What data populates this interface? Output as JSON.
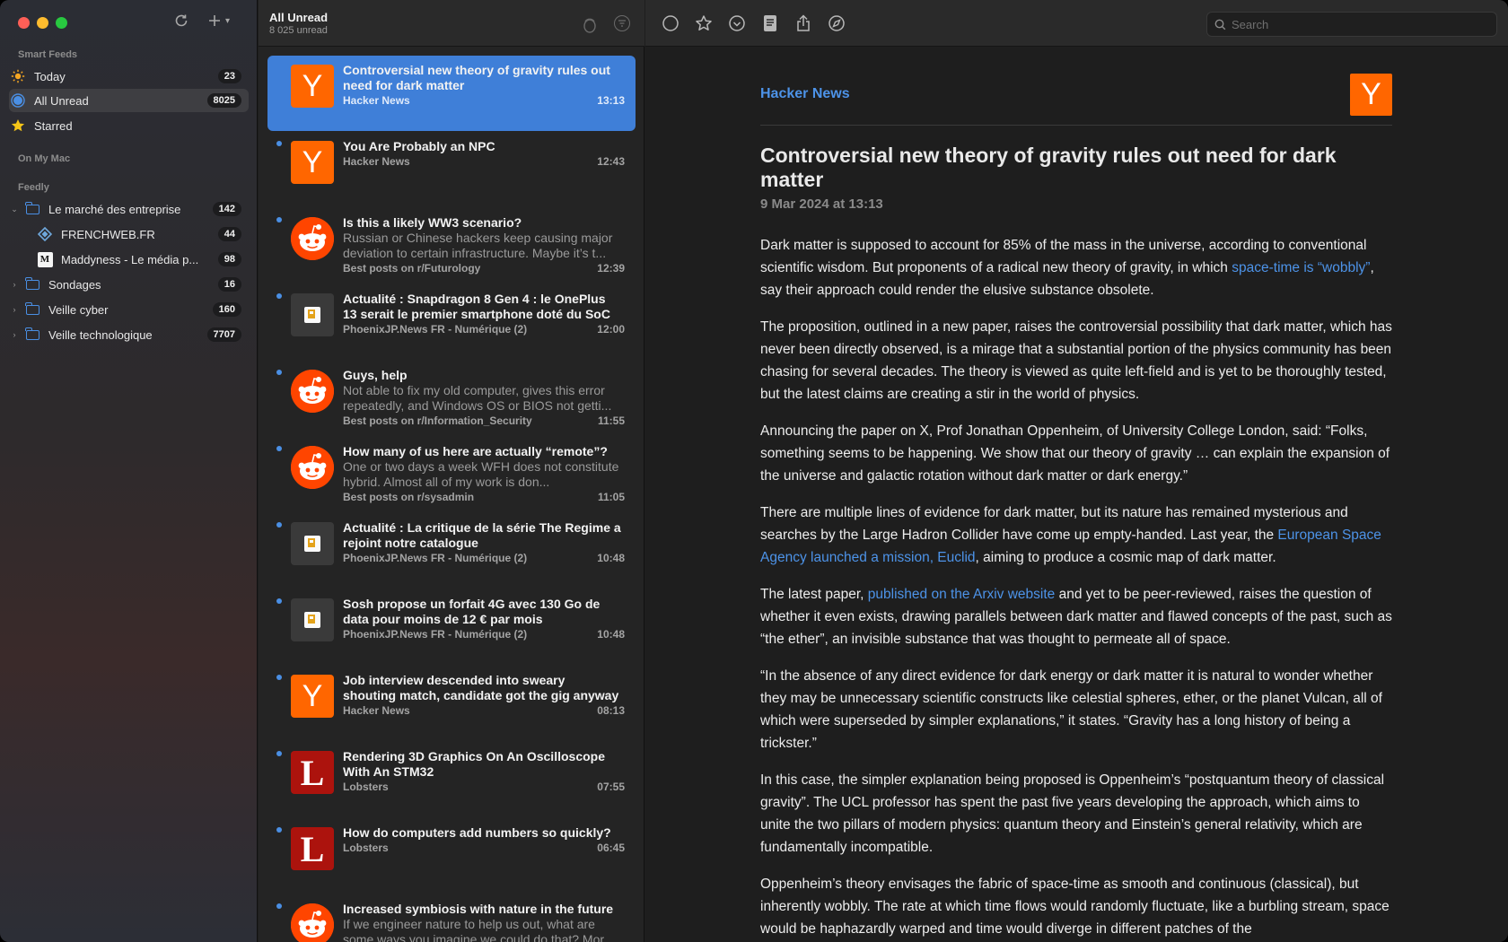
{
  "sidebar": {
    "sections": {
      "smart_feeds": "Smart Feeds",
      "on_my_mac": "On My Mac",
      "feedly": "Feedly"
    },
    "smart": [
      {
        "label": "Today",
        "count": "23",
        "icon": "sun-icon"
      },
      {
        "label": "All Unread",
        "count": "8025",
        "icon": "unread-circle-icon"
      },
      {
        "label": "Starred",
        "count": "",
        "icon": "star-icon"
      }
    ],
    "feedly": [
      {
        "label": "Le marché des entreprise",
        "count": "142"
      },
      {
        "label": "FRENCHWEB.FR",
        "count": "44"
      },
      {
        "label": "Maddyness - Le média p...",
        "count": "98"
      },
      {
        "label": "Sondages",
        "count": "16"
      },
      {
        "label": "Veille cyber",
        "count": "160"
      },
      {
        "label": "Veille technologique",
        "count": "7707"
      }
    ]
  },
  "list": {
    "title": "All Unread",
    "subtitle": "8 025 unread",
    "articles": [
      {
        "title": "Controversial new theory of gravity rules out need for dark matter",
        "excerpt": "",
        "source": "Hacker News",
        "time": "13:13"
      },
      {
        "title": "You Are Probably an NPC",
        "excerpt": "",
        "source": "Hacker News",
        "time": "12:43"
      },
      {
        "title": "Is this a likely WW3 scenario?",
        "excerpt": "Russian or Chinese hackers keep causing major deviation to certain infrastructure. Maybe it’s t...",
        "source": "Best posts on r/Futurology",
        "time": "12:39"
      },
      {
        "title": "Actualité : Snapdragon 8 Gen 4 : le OnePlus 13 serait le premier smartphone doté du SoC",
        "excerpt": "",
        "source": "PhoenixJP.News FR - Numérique (2)",
        "time": "12:00"
      },
      {
        "title": "Guys, help",
        "excerpt": "Not able to fix my old computer, gives this error repeatedly, and Windows OS or BIOS not getti...",
        "source": "Best posts on r/Information_Security",
        "time": "11:55"
      },
      {
        "title": "How many of us here are actually “remote”?",
        "excerpt": "One or two days a week WFH does not constitute hybrid. Almost all of my work is don...",
        "source": "Best posts on r/sysadmin",
        "time": "11:05"
      },
      {
        "title": "Actualité : La critique de la série The Regime a rejoint notre catalogue",
        "excerpt": "",
        "source": "PhoenixJP.News FR - Numérique (2)",
        "time": "10:48"
      },
      {
        "title": "Sosh propose un forfait 4G avec 130 Go de data pour moins de 12 € par mois",
        "excerpt": "",
        "source": "PhoenixJP.News FR - Numérique (2)",
        "time": "10:48"
      },
      {
        "title": "Job interview descended into sweary shouting match, candidate got the gig anyway",
        "excerpt": "",
        "source": "Hacker News",
        "time": "08:13"
      },
      {
        "title": "Rendering 3D Graphics On An Oscilloscope With An STM32",
        "excerpt": "",
        "source": "Lobsters",
        "time": "07:55"
      },
      {
        "title": "How do computers add numbers so quickly?",
        "excerpt": "",
        "source": "Lobsters",
        "time": "06:45"
      },
      {
        "title": "Increased symbiosis with nature in the future",
        "excerpt": "If we engineer nature to help us out, what are some ways you imagine we could do that? Mor...",
        "source": "",
        "time": ""
      }
    ]
  },
  "reader": {
    "search_placeholder": "Search",
    "source": "Hacker News",
    "title": "Controversial new theory of gravity rules out need for dark matter",
    "date": "9 Mar 2024 at 13:13",
    "p1a": "Dark matter is supposed to account for 85% of the mass in the universe, according to conventional scientific wisdom. But proponents of a radical new theory of gravity, in which ",
    "p1link": "space-time is “wobbly”",
    "p1b": ", say their approach could render the elusive substance obsolete.",
    "p2": "The proposition, outlined in a new paper, raises the controversial possibility that dark matter, which has never been directly observed, is a mirage that a substantial portion of the physics community has been chasing for several decades. The theory is viewed as quite left-field and is yet to be thoroughly tested, but the latest claims are creating a stir in the world of physics.",
    "p3": "Announcing the paper on X, Prof Jonathan Oppenheim, of University College London, said: “Folks, something seems to be happening. We show that our theory of gravity … can explain the expansion of the universe and galactic rotation without dark matter or dark energy.”",
    "p4a": "There are multiple lines of evidence for dark matter, but its nature has remained mysterious and searches by the Large Hadron Collider have come up empty-handed. Last year, the ",
    "p4link": "European Space Agency launched a mission, Euclid",
    "p4b": ", aiming to produce a cosmic map of dark matter.",
    "p5a": "The latest paper, ",
    "p5link": "published on the Arxiv website",
    "p5b": " and yet to be peer-reviewed, raises the question of whether it even exists, drawing parallels between dark matter and flawed concepts of the past, such as “the ether”, an invisible substance that was thought to permeate all of space.",
    "p6": "“In the absence of any direct evidence for dark energy or dark matter it is natural to wonder whether they may be unnecessary scientific constructs like celestial spheres, ether, or the planet Vulcan, all of which were superseded by simpler explanations,” it states. “Gravity has a long history of being a trickster.”",
    "p7": "In this case, the simpler explanation being proposed is Oppenheim’s “postquantum theory of classical gravity”. The UCL professor has spent the past five years developing the approach, which aims to unite the two pillars of modern physics: quantum theory and Einstein’s general relativity, which are fundamentally incompatible.",
    "p8": "Oppenheim’s theory envisages the fabric of space-time as smooth and continuous (classical), but inherently wobbly. The rate at which time flows would randomly fluctuate, like a burbling stream, space would be haphazardly warped and time would diverge in different patches of the"
  },
  "colors": {
    "accent": "#4a8fe4",
    "selection": "#3f7fd8",
    "hn": "#ff6600",
    "reddit": "#ff4500",
    "lobsters": "#ac130d"
  }
}
